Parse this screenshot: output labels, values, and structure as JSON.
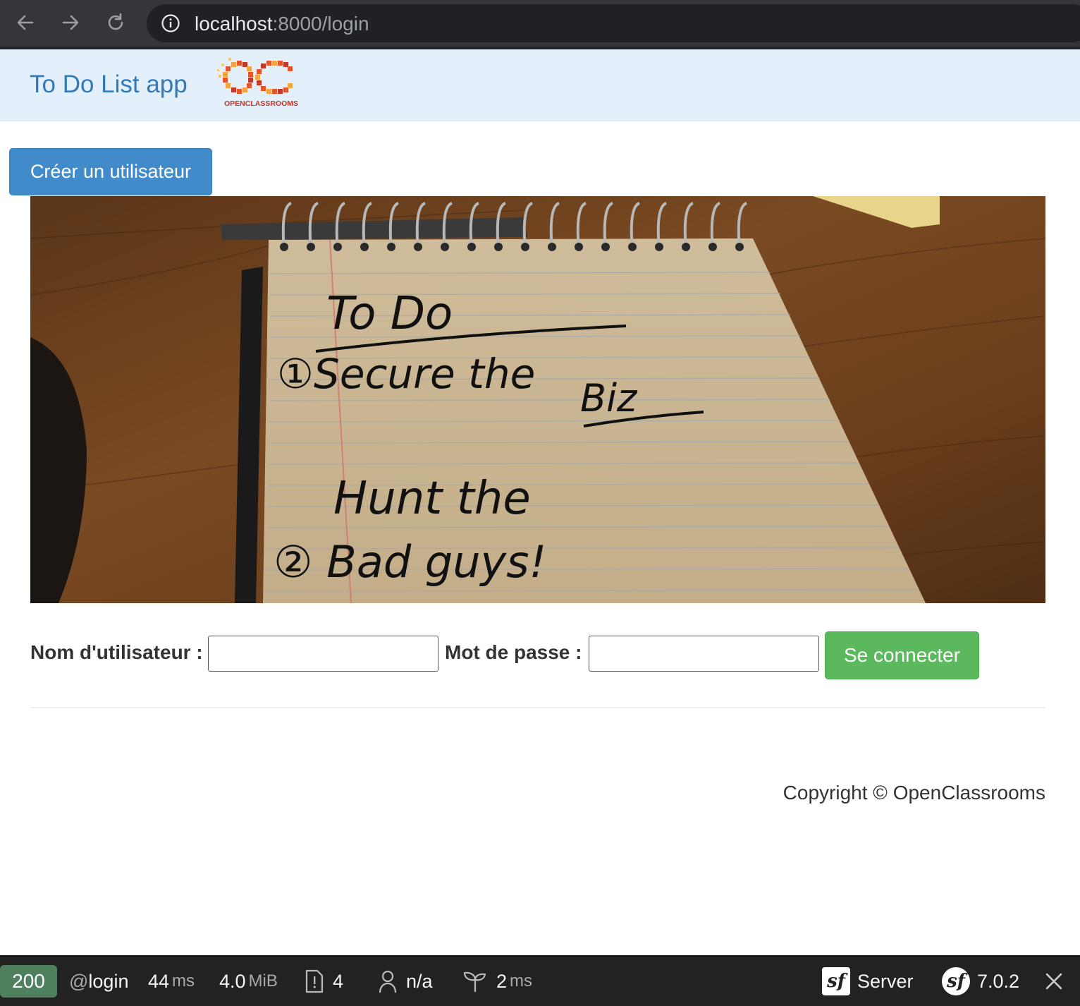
{
  "browser": {
    "url_host": "localhost",
    "url_rest": ":8000/login",
    "icons": [
      "back-icon",
      "forward-icon",
      "reload-icon",
      "info-icon"
    ]
  },
  "navbar": {
    "brand": "To Do List app",
    "logo_text": "OPENCLASSROOMS",
    "logo_letters": "OC"
  },
  "actions": {
    "create_user_label": "Créer un utilisateur"
  },
  "hero": {
    "lines": [
      "To Do",
      "①Secure the",
      "Biz",
      "Hunt the",
      "② Bad guys!"
    ]
  },
  "login_form": {
    "username_label": "Nom d'utilisateur :",
    "username_value": "",
    "password_label": "Mot de passe :",
    "password_value": "",
    "submit_label": "Se connecter"
  },
  "footer": {
    "copyright": "Copyright © OpenClassrooms"
  },
  "debug_toolbar": {
    "status_code": "200",
    "route_prefix": "@",
    "route": "login",
    "time_value": "44",
    "time_unit": "ms",
    "memory_value": "4.0",
    "memory_unit": "MiB",
    "log_count": "4",
    "user": "n/a",
    "twig_time_value": "2",
    "twig_time_unit": "ms",
    "server_label": "Server",
    "version": "7.0.2",
    "colors": {
      "status_ok": "#4f805d",
      "bar_bg": "#222222"
    }
  },
  "colors": {
    "brand": "#337ab7",
    "navbar_bg": "#e3f0fb",
    "primary_button": "#428bca",
    "success_button": "#5cb85c"
  }
}
